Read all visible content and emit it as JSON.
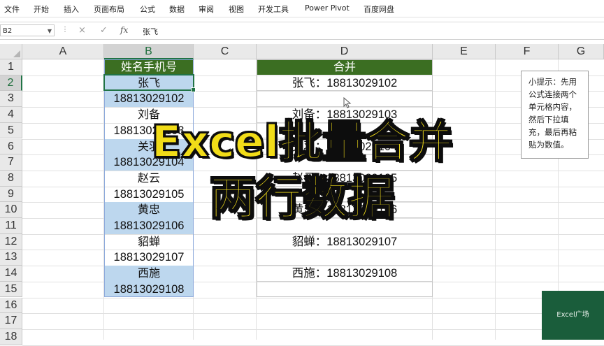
{
  "ribbon": {
    "tabs": [
      "文件",
      "开始",
      "插入",
      "页面布局",
      "公式",
      "数据",
      "审阅",
      "视图",
      "开发工具",
      "Power Pivot",
      "百度网盘"
    ]
  },
  "formula_bar": {
    "name_box": "B2",
    "fx_label": "fx",
    "content": "张飞",
    "cancel_icon": "×",
    "enter_icon": "✓"
  },
  "columns": [
    "A",
    "B",
    "C",
    "D",
    "E",
    "F",
    "G"
  ],
  "rows": [
    "1",
    "2",
    "3",
    "4",
    "5",
    "6",
    "7",
    "8",
    "9",
    "10",
    "11",
    "12",
    "13",
    "14",
    "15",
    "16",
    "17",
    "18"
  ],
  "table_b": {
    "header": "姓名手机号",
    "cells": [
      "张飞",
      "18813029102",
      "刘备",
      "18813029103",
      "关羽",
      "18813029104",
      "赵云",
      "18813029105",
      "黄忠",
      "18813029106",
      "貂蝉",
      "18813029107",
      "西施",
      "18813029108"
    ]
  },
  "table_d": {
    "header": "合并",
    "cells": [
      "张飞：18813029102",
      "",
      "刘备：18813029103",
      "",
      "关羽：18813029104",
      "",
      "赵云：18813029105",
      "",
      "黄忠：18813029106",
      "",
      "貂蝉：18813029107",
      "",
      "西施：18813029108",
      ""
    ]
  },
  "note": {
    "text": "小提示：先用公式连接两个单元格内容，然后下拉填充，最后再粘贴为数值。"
  },
  "overlay": {
    "line1": "Excel批量合并",
    "line2": "两行数据"
  },
  "watermark": "Excel广场",
  "colors": {
    "header_green": "#3b6e22",
    "band_blue": "#bdd7ee",
    "overlay_yellow": "#f1dc18",
    "select_green": "#217346"
  }
}
